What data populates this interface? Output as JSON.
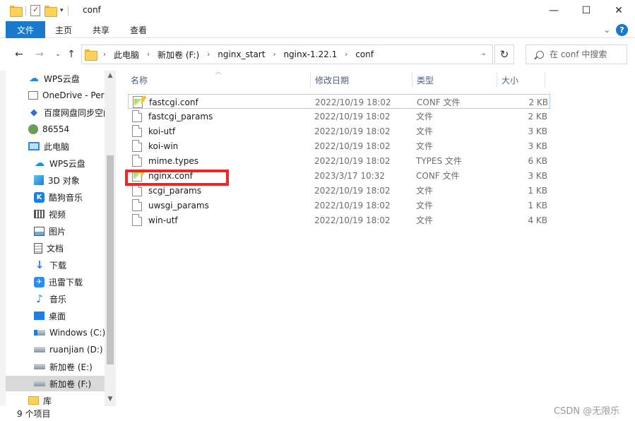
{
  "window": {
    "title": "conf",
    "controls": {
      "minimize": "—",
      "maximize": "☐",
      "close": "✕"
    }
  },
  "ribbon": {
    "tabs": [
      {
        "label": "文件",
        "active": true
      },
      {
        "label": "主页"
      },
      {
        "label": "共享"
      },
      {
        "label": "查看"
      }
    ],
    "help": "?"
  },
  "address": {
    "breadcrumb": [
      "此电脑",
      "新加卷 (F:)",
      "nginx_start",
      "nginx-1.22.1",
      "conf"
    ],
    "search_placeholder": "在 conf 中搜索"
  },
  "nav": {
    "items": [
      {
        "label": "WPS云盘",
        "icon": "cloud-icon"
      },
      {
        "label": "OneDrive - Per",
        "icon": "onedrive-icon"
      },
      {
        "label": "百度网盘同步空间",
        "icon": "baidu-icon"
      },
      {
        "label": "86554",
        "icon": "user-icon"
      },
      {
        "label": "此电脑",
        "icon": "pc-icon"
      },
      {
        "label": "WPS云盘",
        "icon": "cloud-icon"
      },
      {
        "label": "3D 对象",
        "icon": "cube-icon"
      },
      {
        "label": "酷狗音乐",
        "icon": "kugou-icon"
      },
      {
        "label": "视频",
        "icon": "video-icon"
      },
      {
        "label": "图片",
        "icon": "picture-icon"
      },
      {
        "label": "文档",
        "icon": "document-icon"
      },
      {
        "label": "下载",
        "icon": "download-icon"
      },
      {
        "label": "迅雷下载",
        "icon": "xunlei-icon"
      },
      {
        "label": "音乐",
        "icon": "music-icon"
      },
      {
        "label": "桌面",
        "icon": "desktop-icon"
      },
      {
        "label": "Windows (C:)",
        "icon": "drive-icon"
      },
      {
        "label": "ruanjian  (D:)",
        "icon": "drive-icon"
      },
      {
        "label": "新加卷 (E:)",
        "icon": "drive-icon"
      },
      {
        "label": "新加卷 (F:)",
        "icon": "drive-icon",
        "selected": true
      },
      {
        "label": "库",
        "icon": "library-icon"
      }
    ]
  },
  "columns": {
    "name": "名称",
    "modified": "修改日期",
    "type": "类型",
    "size": "大小"
  },
  "files": [
    {
      "name": "fastcgi.conf",
      "modified": "2022/10/19 18:02",
      "type": "CONF 文件",
      "size": "2 KB",
      "icon": "conf-icon"
    },
    {
      "name": "fastcgi_params",
      "modified": "2022/10/19 18:02",
      "type": "文件",
      "size": "2 KB",
      "icon": "file-icon"
    },
    {
      "name": "koi-utf",
      "modified": "2022/10/19 18:02",
      "type": "文件",
      "size": "3 KB",
      "icon": "file-icon"
    },
    {
      "name": "koi-win",
      "modified": "2022/10/19 18:02",
      "type": "文件",
      "size": "3 KB",
      "icon": "file-icon"
    },
    {
      "name": "mime.types",
      "modified": "2022/10/19 18:02",
      "type": "TYPES 文件",
      "size": "6 KB",
      "icon": "file-icon"
    },
    {
      "name": "nginx.conf",
      "modified": "2023/3/17 10:32",
      "type": "CONF 文件",
      "size": "3 KB",
      "icon": "conf-icon"
    },
    {
      "name": "scgi_params",
      "modified": "2022/10/19 18:02",
      "type": "文件",
      "size": "1 KB",
      "icon": "file-icon"
    },
    {
      "name": "uwsgi_params",
      "modified": "2022/10/19 18:02",
      "type": "文件",
      "size": "1 KB",
      "icon": "file-icon"
    },
    {
      "name": "win-utf",
      "modified": "2022/10/19 18:02",
      "type": "文件",
      "size": "4 KB",
      "icon": "file-icon"
    }
  ],
  "status": {
    "count": "9 个项目"
  },
  "watermark": "CSDN @无限乐",
  "colors": {
    "accent": "#1979ca",
    "highlight": "#ec2727",
    "selection": "#d9d9d9",
    "focus": "#99d1ff"
  }
}
